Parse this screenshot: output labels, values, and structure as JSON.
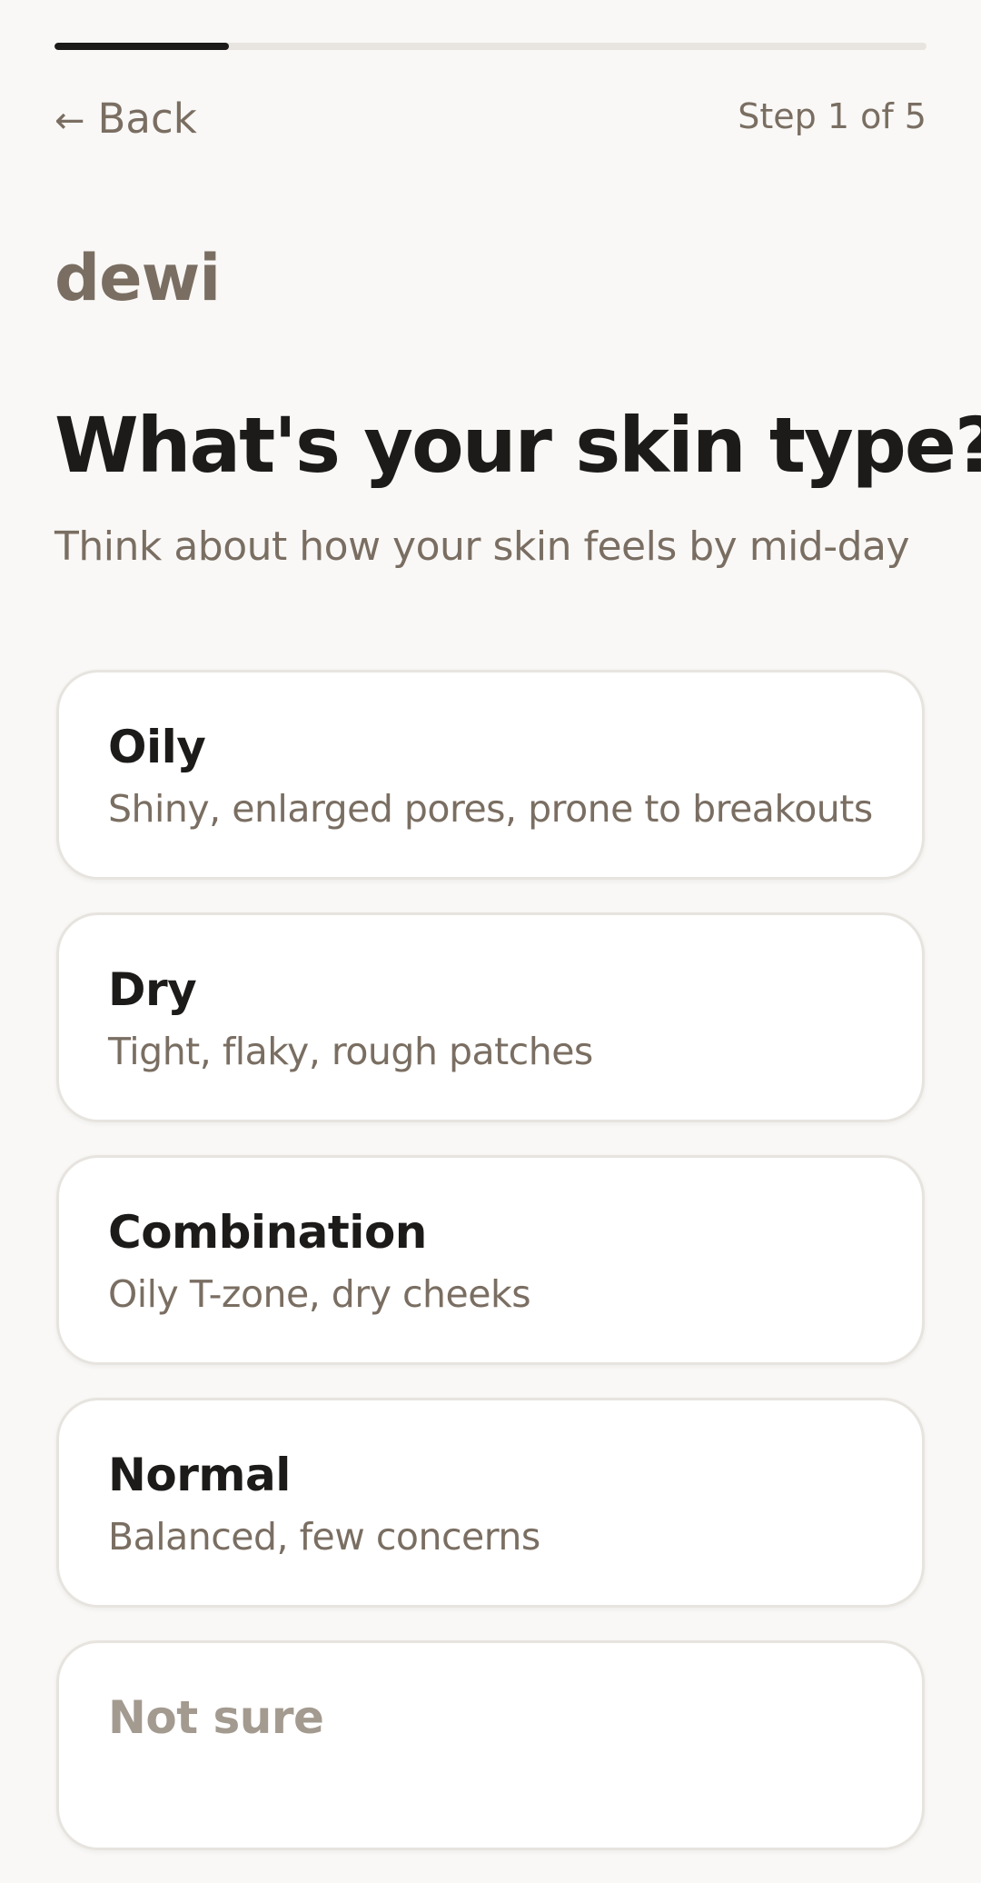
{
  "progress": {
    "fraction": 0.2
  },
  "header": {
    "back_icon": "←",
    "back_label": "Back",
    "step_text": "Step 1 of 5"
  },
  "brand": {
    "name": "dewi"
  },
  "question": {
    "title": "What's your skin type?",
    "subtitle": "Think about how your skin feels by mid-day"
  },
  "options": [
    {
      "title": "Oily",
      "desc": "Shiny, enlarged pores, prone to breakouts"
    },
    {
      "title": "Dry",
      "desc": "Tight, flaky, rough patches"
    },
    {
      "title": "Combination",
      "desc": "Oily T-zone, dry cheeks"
    },
    {
      "title": "Normal",
      "desc": "Balanced, few concerns"
    },
    {
      "title": "Not sure",
      "desc": ""
    }
  ],
  "colors": {
    "background": "#f9f8f6",
    "text_primary": "#1c1b1a",
    "text_secondary": "#7a6e62",
    "card_border": "#e7e4df",
    "progress_track": "#e8e5e0",
    "progress_fill": "#1c1b1a"
  }
}
